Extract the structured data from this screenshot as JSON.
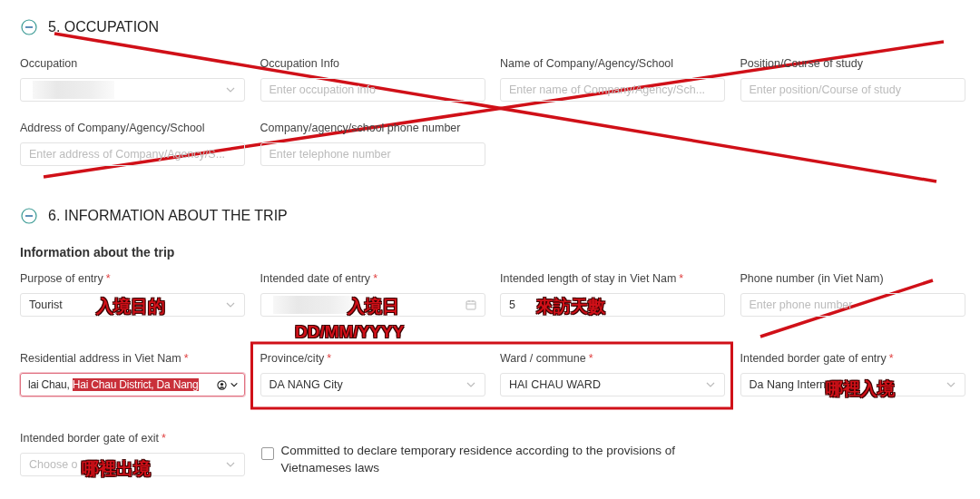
{
  "sections": [
    {
      "title": "5. OCCUPATION",
      "expanded": true,
      "fields": [
        {
          "kind": "select",
          "label": "Occupation",
          "blurred": true
        },
        {
          "kind": "input",
          "label": "Occupation Info",
          "placeholder": "Enter occupation info"
        },
        {
          "kind": "input",
          "label": "Name of Company/Agency/School",
          "placeholder": "Enter name of Company/Agency/Sch..."
        },
        {
          "kind": "input",
          "label": "Position/Course of study",
          "placeholder": "Enter position/Course of study"
        },
        {
          "kind": "input",
          "label": "Address of Company/Agency/School",
          "placeholder": "Enter address of Company/Agency/S..."
        },
        {
          "kind": "input",
          "label": "Company/agency/school phone number",
          "placeholder": "Enter telephone number"
        }
      ]
    },
    {
      "title": "6. INFORMATION ABOUT THE TRIP",
      "expanded": true,
      "subtitle": "Information about the trip",
      "fields": [
        {
          "kind": "select",
          "label": "Purpose of entry",
          "required_mark": "*",
          "value": "Tourist"
        },
        {
          "kind": "date",
          "label": "Intended date of entry",
          "required_mark": "*",
          "blurred": true
        },
        {
          "kind": "input",
          "label": "Intended length of stay in Viet Nam",
          "required_mark": "*",
          "value": "5"
        },
        {
          "kind": "input",
          "label": "Phone number (in Viet Nam)",
          "placeholder": "Enter phone number"
        },
        {
          "kind": "address",
          "label": "Residential address in Viet Nam",
          "required_mark": "*",
          "value": "lai Chau, ",
          "highlighted": "Hai Chau District, Da Nang",
          "error": true
        },
        {
          "kind": "select",
          "label": "Province/city",
          "required_mark": "*",
          "value": "DA NANG City"
        },
        {
          "kind": "select",
          "label": "Ward / commune",
          "required_mark": "*",
          "value": "HAI CHAU WARD"
        },
        {
          "kind": "select",
          "label": "Intended border gate of entry",
          "required_mark": "*",
          "value": "Da Nang Intern"
        },
        {
          "kind": "select",
          "label": "Intended border gate of exit",
          "required_mark": "*",
          "placeholder": "Choose o"
        },
        {
          "kind": "checkbox",
          "label": "Committed to declare temporary residence according to the provisions of Vietnameses laws",
          "checked": false
        }
      ]
    }
  ],
  "annotations": [
    {
      "text": "入境目的"
    },
    {
      "text": "入境日"
    },
    {
      "text": "DD/MM/YYYY"
    },
    {
      "text": "來訪天數"
    },
    {
      "text": "哪裡入境"
    },
    {
      "text": "哪裡出境"
    }
  ]
}
